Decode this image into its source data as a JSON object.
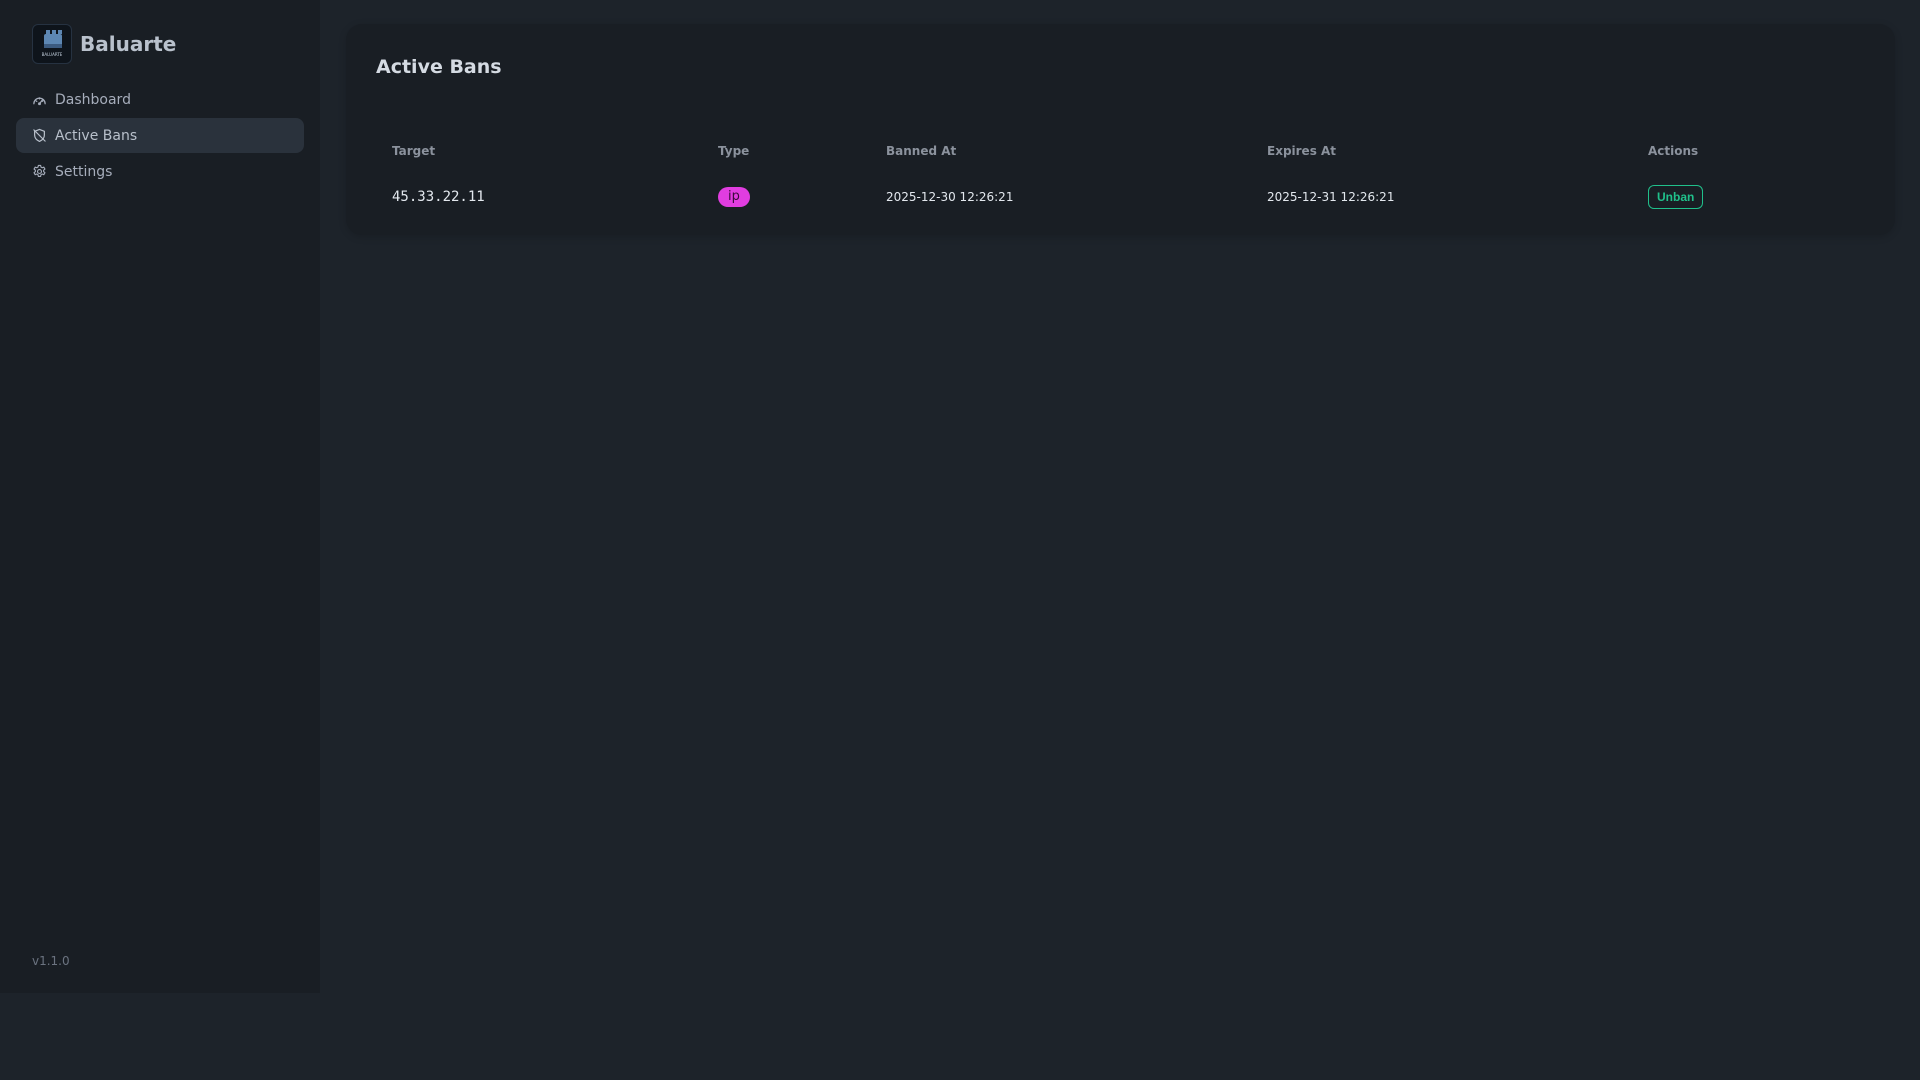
{
  "app": {
    "name": "Baluarte",
    "logo_text": "BALUARTE",
    "version": "v1.1.0"
  },
  "sidebar": {
    "items": [
      {
        "label": "Dashboard",
        "icon": "gauge-icon",
        "active": false
      },
      {
        "label": "Active Bans",
        "icon": "shield-off-icon",
        "active": true
      },
      {
        "label": "Settings",
        "icon": "gear-icon",
        "active": false
      }
    ]
  },
  "main": {
    "title": "Active Bans",
    "table": {
      "headers": [
        "Target",
        "Type",
        "Banned At",
        "Expires At",
        "Actions"
      ],
      "rows": [
        {
          "target": "45.33.22.11",
          "type": "ip",
          "banned_at": "2025-12-30 12:26:21",
          "expires_at": "2025-12-31 12:26:21",
          "action_label": "Unban"
        }
      ]
    }
  },
  "colors": {
    "background": "#1d232a",
    "sidebar": "#191e24",
    "active_item": "#2a323c",
    "badge_ip": "#e13de0",
    "success": "#20c08b"
  }
}
